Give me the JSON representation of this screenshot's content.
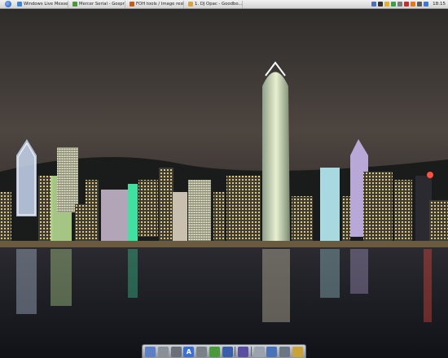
{
  "panel": {
    "tasks": [
      {
        "label": "Windows Live Messen...",
        "icon": "messenger-icon",
        "color": "#3a86d6"
      },
      {
        "label": "Mercer Serial - Gosprek",
        "icon": "browser-icon",
        "color": "#4a9a3a"
      },
      {
        "label": "FOH tools / Image resi...",
        "icon": "browser-icon",
        "color": "#c55a1a"
      },
      {
        "label": "1. DJ Opac - Goodbo...",
        "icon": "music-icon",
        "color": "#d9a43a"
      }
    ],
    "tray_icons": [
      "#4a6fb5",
      "#333333",
      "#e0b030",
      "#3aa04a",
      "#7a7a7a",
      "#c03030",
      "#e07a20",
      "#5a5a5a",
      "#3a7ad0"
    ],
    "clock": "18:15"
  },
  "dock": {
    "items": [
      {
        "name": "finder-icon",
        "color": "#5c7fc8",
        "glyph": ""
      },
      {
        "name": "clock-icon",
        "color": "#8a8f98",
        "glyph": ""
      },
      {
        "name": "dashboard-icon",
        "color": "#6a6f79",
        "glyph": ""
      },
      {
        "name": "app-store-icon",
        "color": "#3b6fd4",
        "glyph": "A"
      },
      {
        "name": "system-preferences-icon",
        "color": "#7a8088",
        "glyph": ""
      },
      {
        "name": "chat-icon",
        "color": "#4a9a3a",
        "glyph": ""
      },
      {
        "name": "music-icon",
        "color": "#3a5fa8",
        "glyph": ""
      },
      {
        "name": "shield-icon",
        "color": "#5a4ea0",
        "glyph": ""
      },
      {
        "name": "folder-icon",
        "color": "#9aa3ad",
        "glyph": ""
      },
      {
        "name": "network-icon",
        "color": "#4a72b8",
        "glyph": ""
      },
      {
        "name": "photo-icon",
        "color": "#6a7686",
        "glyph": ""
      },
      {
        "name": "trash-icon",
        "color": "#c9a23a",
        "glyph": ""
      }
    ]
  },
  "colors": {
    "sky_top": "#3c3936",
    "sky_mid": "#5a4e45",
    "water": "#1a1d24"
  }
}
